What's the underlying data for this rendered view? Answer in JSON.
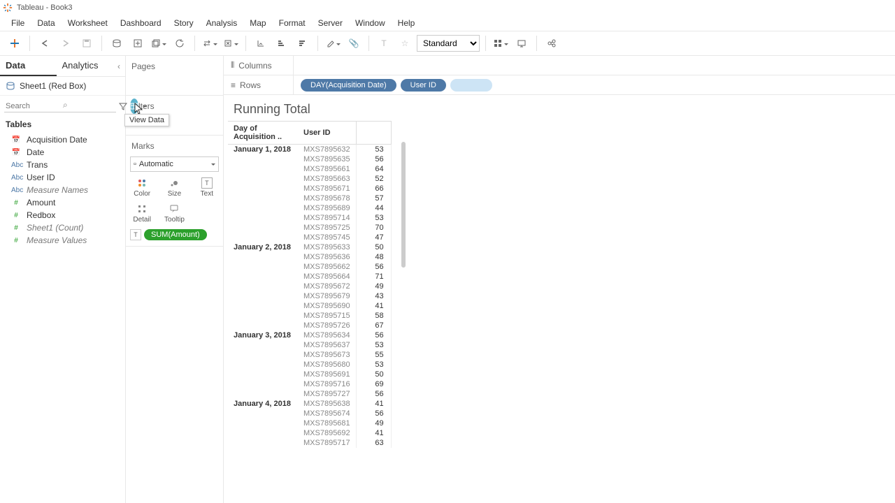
{
  "window": {
    "title": "Tableau - Book3"
  },
  "menu": [
    "File",
    "Data",
    "Worksheet",
    "Dashboard",
    "Story",
    "Analysis",
    "Map",
    "Format",
    "Server",
    "Window",
    "Help"
  ],
  "toolbar": {
    "fit_mode": "Standard"
  },
  "side": {
    "tab_data": "Data",
    "tab_analytics": "Analytics",
    "datasource": "Sheet1 (Red Box)",
    "search_placeholder": "Search",
    "viewdata_tooltip": "View Data",
    "tables_header": "Tables",
    "fields": [
      {
        "icon": "📅",
        "cls": "dim",
        "name": "Acquisition Date"
      },
      {
        "icon": "📅",
        "cls": "dim",
        "name": "Date"
      },
      {
        "icon": "Abc",
        "cls": "dim",
        "name": "Trans"
      },
      {
        "icon": "Abc",
        "cls": "dim",
        "name": "User ID"
      },
      {
        "icon": "Abc",
        "cls": "dim",
        "name": "Measure Names",
        "italic": true
      },
      {
        "icon": "#",
        "cls": "meas",
        "name": "Amount"
      },
      {
        "icon": "#",
        "cls": "meas",
        "name": "Redbox"
      },
      {
        "icon": "#",
        "cls": "meas",
        "name": "Sheet1 (Count)",
        "italic": true
      },
      {
        "icon": "#",
        "cls": "meas",
        "name": "Measure Values",
        "italic": true
      }
    ]
  },
  "cards": {
    "pages": "Pages",
    "filters": "Filters",
    "marks": "Marks",
    "marks_type": "Automatic",
    "mark_btns": {
      "color": "Color",
      "size": "Size",
      "text": "Text",
      "detail": "Detail",
      "tooltip": "Tooltip"
    },
    "text_pill": "SUM(Amount)"
  },
  "shelves": {
    "columns": "Columns",
    "rows": "Rows",
    "row_pills": [
      "DAY(Acquisition Date)",
      "User ID"
    ]
  },
  "viz": {
    "title": "Running Total",
    "headers": [
      "Day of Acquisition ..",
      "User ID",
      ""
    ],
    "groups": [
      {
        "date": "January 1, 2018",
        "rows": [
          [
            "MXS7895632",
            53
          ],
          [
            "MXS7895635",
            56
          ],
          [
            "MXS7895661",
            64
          ],
          [
            "MXS7895663",
            52
          ],
          [
            "MXS7895671",
            66
          ],
          [
            "MXS7895678",
            57
          ],
          [
            "MXS7895689",
            44
          ],
          [
            "MXS7895714",
            53
          ],
          [
            "MXS7895725",
            70
          ],
          [
            "MXS7895745",
            47
          ]
        ]
      },
      {
        "date": "January 2, 2018",
        "rows": [
          [
            "MXS7895633",
            50
          ],
          [
            "MXS7895636",
            48
          ],
          [
            "MXS7895662",
            56
          ],
          [
            "MXS7895664",
            71
          ],
          [
            "MXS7895672",
            49
          ],
          [
            "MXS7895679",
            43
          ],
          [
            "MXS7895690",
            41
          ],
          [
            "MXS7895715",
            58
          ],
          [
            "MXS7895726",
            67
          ]
        ]
      },
      {
        "date": "January 3, 2018",
        "rows": [
          [
            "MXS7895634",
            56
          ],
          [
            "MXS7895637",
            53
          ],
          [
            "MXS7895673",
            55
          ],
          [
            "MXS7895680",
            53
          ],
          [
            "MXS7895691",
            50
          ],
          [
            "MXS7895716",
            69
          ],
          [
            "MXS7895727",
            56
          ]
        ]
      },
      {
        "date": "January 4, 2018",
        "rows": [
          [
            "MXS7895638",
            41
          ],
          [
            "MXS7895674",
            56
          ],
          [
            "MXS7895681",
            49
          ],
          [
            "MXS7895692",
            41
          ],
          [
            "MXS7895717",
            63
          ]
        ]
      }
    ]
  }
}
